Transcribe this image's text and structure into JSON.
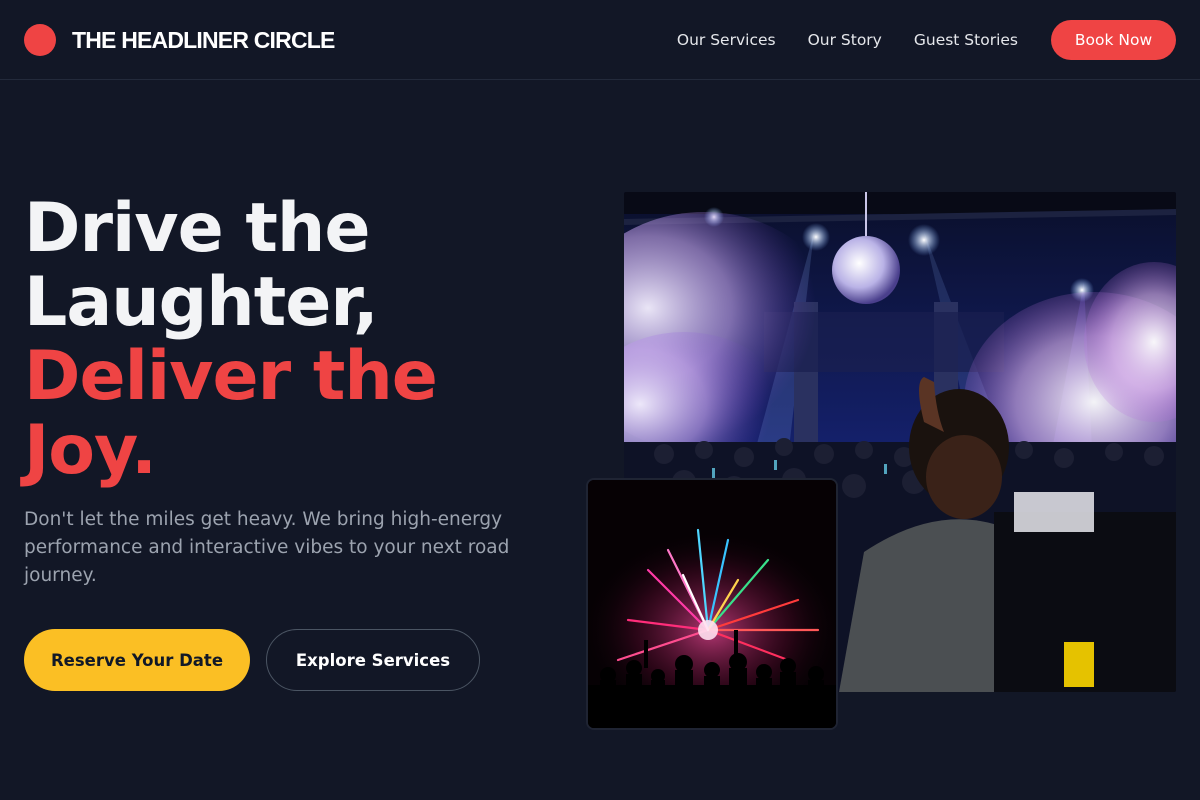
{
  "brand": {
    "name": "THE HEADLINER CIRCLE",
    "accent": "#ef4444"
  },
  "nav": {
    "items": [
      "Our Services",
      "Our Story",
      "Guest Stories"
    ],
    "cta": "Book Now"
  },
  "hero": {
    "headline_white_1": "Drive the",
    "headline_white_2": "Laughter,",
    "headline_red_1": "Deliver the",
    "headline_red_2": "Joy.",
    "subtext": "Don't let the miles get heavy. We bring high-energy performance and interactive vibes to your next road journey.",
    "primary_button": "Reserve Your Date",
    "secondary_button": "Explore Services"
  },
  "images": {
    "main": "concert-dj-crowd-photo",
    "inset": "fireworks-crowd-photo"
  },
  "colors": {
    "background": "#121726",
    "primary_button": "#fbbf24",
    "headline_red": "#ef4444"
  }
}
